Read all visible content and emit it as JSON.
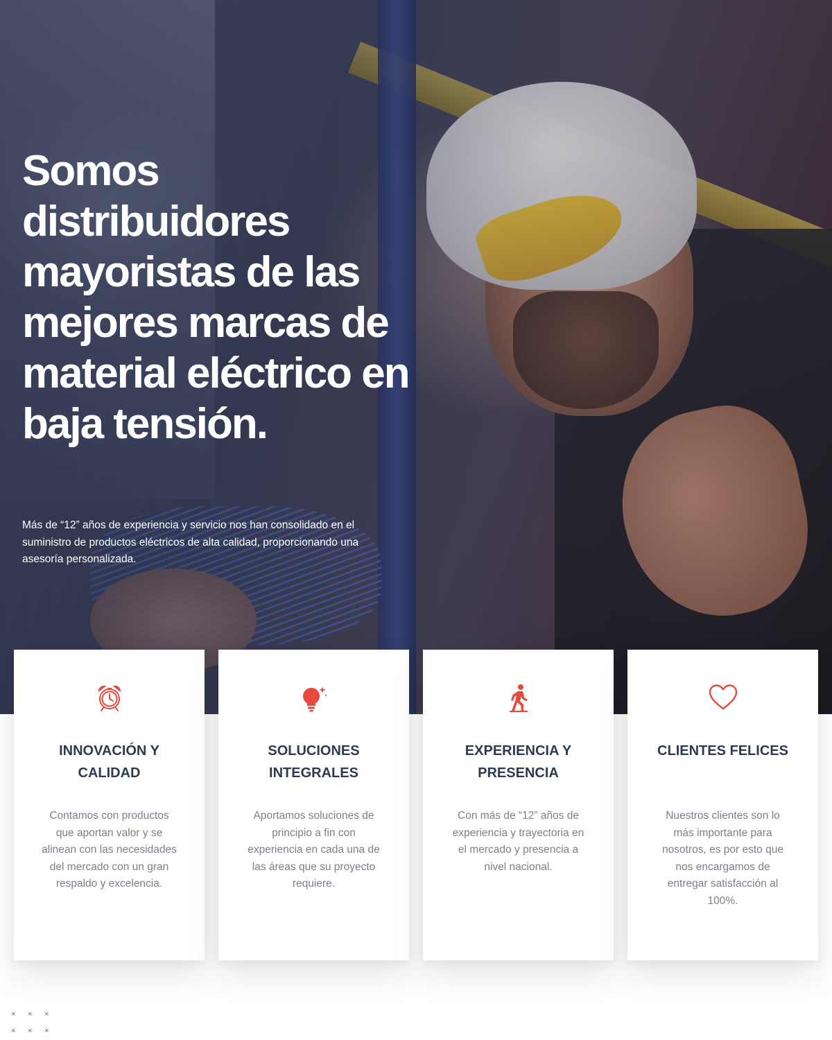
{
  "hero": {
    "title": "Somos distribuidores mayoristas de las mejores marcas de material eléctrico en baja tensión.",
    "subtitle": "Más de “12” años de experiencia y servicio nos han consolidado en el suministro de productos eléctricos de alta calidad, proporcionando una asesoría personalizada."
  },
  "colors": {
    "accent": "#e8493d",
    "card_title": "#2d3b52",
    "card_text": "#7a808a"
  },
  "features": [
    {
      "icon": "alarm-clock-icon",
      "title": "INNOVACIÓN Y CALIDAD",
      "text": "Contamos con productos que aportan valor y se alinean con las necesidades del mercado con un gran respaldo y excelencia."
    },
    {
      "icon": "lightbulb-icon",
      "title": "SOLUCIONES INTEGRALES",
      "text": "Aportamos soluciones de principio a fin con experiencia en cada una de las áreas que su proyecto requiere."
    },
    {
      "icon": "walking-person-icon",
      "title": "EXPERIENCIA Y PRESENCIA",
      "text": "Con más de “12” años de experiencia y trayectoria en el mercado y presencia a nivel nacional."
    },
    {
      "icon": "heart-icon",
      "title": "CLIENTES FELICES",
      "text": "Nuestros clientes son lo más importante para nosotros, es por esto que nos encargamos de entregar satisfacción al 100%."
    }
  ],
  "decor": {
    "dot_glyph": "×"
  }
}
